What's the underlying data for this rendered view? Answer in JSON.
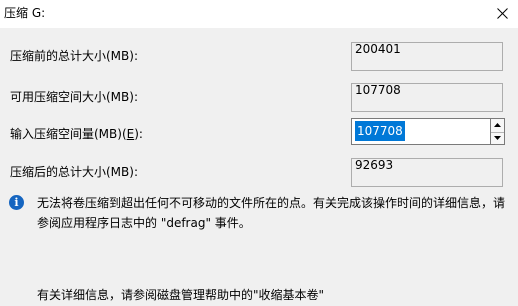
{
  "window": {
    "title": "压缩 G:"
  },
  "rows": {
    "total_before": {
      "label": "压缩前的总计大小(MB):",
      "value": "200401"
    },
    "available": {
      "label": "可用压缩空间大小(MB):",
      "value": "107708"
    },
    "input": {
      "label_prefix": "输入压缩空间量(MB)(",
      "mnemonic": "E",
      "label_suffix": "):",
      "value": "107708"
    },
    "total_after": {
      "label": "压缩后的总计大小(MB):",
      "value": "92693"
    }
  },
  "info": {
    "line1": "无法将卷压缩到超出任何不可移动的文件所在的点。有关完成该操作时间的详细信息，请",
    "line2": "参阅应用程序日志中的 \"defrag\" 事件。"
  },
  "footer": {
    "text": "有关详细信息，请参阅磁盘管理帮助中的\"收缩基本卷\""
  },
  "icons": {
    "close": "close-icon",
    "info": "info-icon",
    "spin_up": "chevron-up-icon",
    "spin_down": "chevron-down-icon"
  },
  "colors": {
    "selection": "#0078d7",
    "info_icon": "#1565c0",
    "window_bg": "#f0f0f0"
  }
}
